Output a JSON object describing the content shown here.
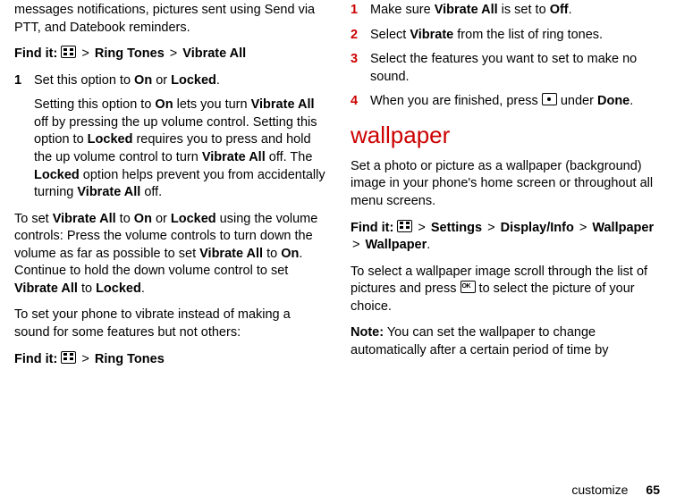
{
  "left": {
    "intro_pre": "messages notifications, pictures sent using Send via PTT, and Datebook reminders.",
    "findit_label": "Find it:",
    "findit_path1_a": "Ring Tones",
    "findit_path1_b": "Vibrate All",
    "step1_num": "1",
    "step1_a": "Set this option to ",
    "step1_b": "On",
    "step1_c": " or ",
    "step1_d": "Locked",
    "step1_e": ".",
    "step1_detail_a": "Setting this option to ",
    "step1_detail_b": "On",
    "step1_detail_c": " lets you turn ",
    "step1_detail_d": "Vibrate All",
    "step1_detail_e": " off by pressing the up volume control. Setting this option to ",
    "step1_detail_f": "Locked",
    "step1_detail_g": " requires you to press and hold the up volume control to turn ",
    "step1_detail_h": "Vibrate All",
    "step1_detail_i": " off. The ",
    "step1_detail_j": "Locked",
    "step1_detail_k": " option helps prevent you from accidentally turning ",
    "step1_detail_l": "Vibrate All",
    "step1_detail_m": " off.",
    "para2_a": "To set ",
    "para2_b": "Vibrate All",
    "para2_c": " to ",
    "para2_d": "On",
    "para2_e": " or ",
    "para2_f": "Locked",
    "para2_g": " using the volume controls: Press the volume controls to turn down the volume as far as possible to set ",
    "para2_h": "Vibrate All",
    "para2_i": " to ",
    "para2_j": "On",
    "para2_k": ". Continue to hold the down volume control to set ",
    "para2_l": "Vibrate All",
    "para2_m": " to ",
    "para2_n": "Locked",
    "para2_o": ".",
    "para3": "To set your phone to vibrate instead of making a sound for some features but not others:",
    "findit2_a": "Ring Tones"
  },
  "right": {
    "s1n": "1",
    "s1a": "Make sure ",
    "s1b": "Vibrate All",
    "s1c": " is set to ",
    "s1d": "Off",
    "s1e": ".",
    "s2n": "2",
    "s2a": "Select ",
    "s2b": "Vibrate",
    "s2c": " from the list of ring tones.",
    "s3n": "3",
    "s3a": "Select the features you want to set to make no sound.",
    "s4n": "4",
    "s4a": "When you are finished, press ",
    "s4b": " under ",
    "s4c": "Done",
    "s4d": ".",
    "heading": "wallpaper",
    "wp1": "Set a photo or picture as a wallpaper (background) image in your phone's home screen or throughout all menu screens.",
    "findit_label": "Find it:",
    "fp1": "Settings",
    "fp2": "Display/Info",
    "fp3": "Wallpaper",
    "fp4": "Wallpaper",
    "wp2a": "To select a wallpaper image scroll through the list of pictures and press ",
    "wp2b": " to select the picture of your choice.",
    "note_label": "Note:",
    "note_text": " You can set the wallpaper to change automatically after a certain period of time by"
  },
  "footer": {
    "label": "customize",
    "page": "65"
  }
}
